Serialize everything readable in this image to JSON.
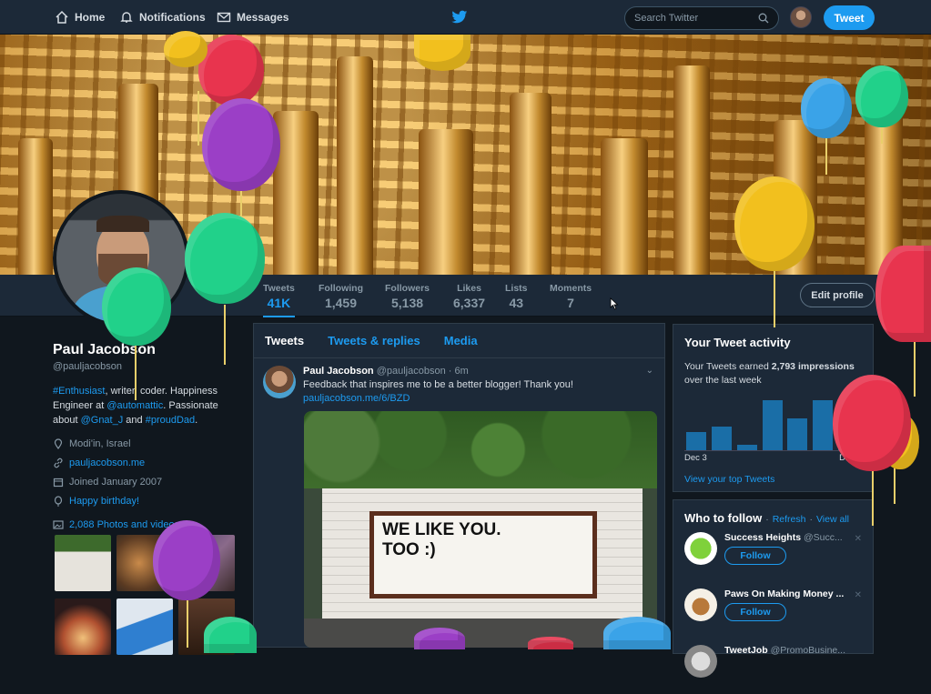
{
  "nav": {
    "home": "Home",
    "notifications": "Notifications",
    "messages": "Messages",
    "search_placeholder": "Search Twitter",
    "tweet_button": "Tweet"
  },
  "stats": [
    {
      "label": "Tweets",
      "value": "41K"
    },
    {
      "label": "Following",
      "value": "1,459"
    },
    {
      "label": "Followers",
      "value": "5,138"
    },
    {
      "label": "Likes",
      "value": "6,337"
    },
    {
      "label": "Lists",
      "value": "43"
    },
    {
      "label": "Moments",
      "value": "7"
    }
  ],
  "edit_profile": "Edit profile",
  "profile": {
    "name": "Paul Jacobson",
    "handle": "@pauljacobson",
    "bio_parts": [
      "#Enthusiast",
      ", writer, coder. Happiness Engineer at ",
      "@automattic",
      ". Passionate about ",
      "@Gnat_J",
      " and ",
      "#proudDad",
      "."
    ],
    "location": "Modi'in, Israel",
    "website": "pauljacobson.me",
    "joined": "Joined January 2007",
    "birthday": "Happy birthday!",
    "photos": "2,088 Photos and videos"
  },
  "timeline": {
    "tabs": [
      "Tweets",
      "Tweets & replies",
      "Media"
    ],
    "tweet": {
      "name": "Paul Jacobson",
      "handle": "@pauljacobson",
      "time": "· 6m",
      "text": "Feedback that inspires me to be a better blogger! Thank you! ",
      "link": "pauljacobson.me/6/BZD",
      "sign": "WE LIKE YOU.\nTOO :)"
    }
  },
  "activity": {
    "title": "Your Tweet activity",
    "text_pre": "Your Tweets earned ",
    "impressions": "2,793 impressions",
    "text_post": " over the last week",
    "date_start": "Dec 3",
    "date_end": "Dec 9",
    "link": "View your top Tweets",
    "bars": [
      0.35,
      0.45,
      0.1,
      0.95,
      0.6,
      0.95,
      0.85
    ]
  },
  "who_to_follow": {
    "title": "Who to follow",
    "refresh": "Refresh",
    "view_all": "View all",
    "follow_label": "Follow",
    "items": [
      {
        "name": "Success Heights",
        "handle": "@Succ..."
      },
      {
        "name": "Paws On Making Money ...",
        "handle": ""
      },
      {
        "name": "TweetJob",
        "handle": "@PromoBusine..."
      }
    ]
  },
  "colors": {
    "accent": "#1d9bf0",
    "background": "#10171e",
    "panel": "#1c2938"
  }
}
